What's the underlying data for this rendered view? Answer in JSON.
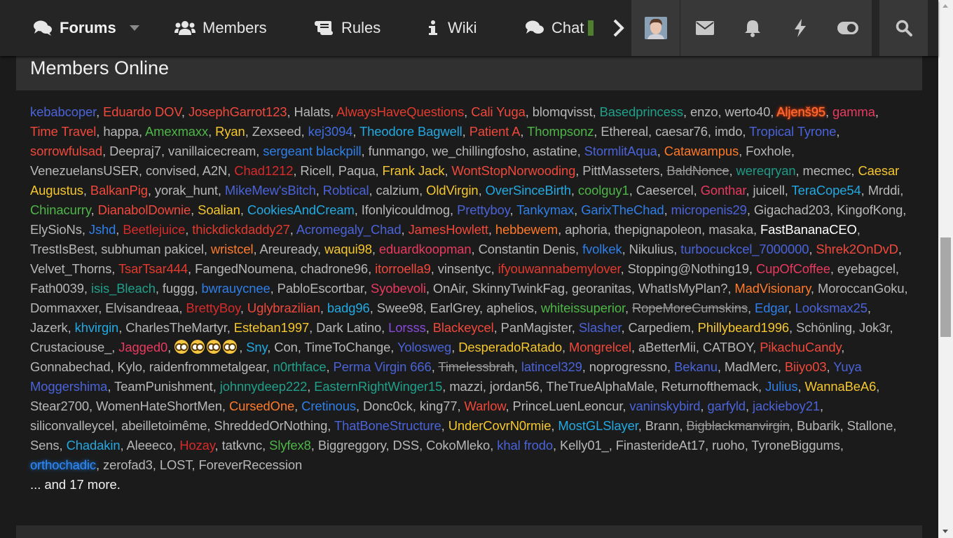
{
  "nav": {
    "forums": "Forums",
    "members": "Members",
    "rules": "Rules",
    "wiki": "Wiki",
    "chat": "Chat"
  },
  "icons": {
    "forums": "comments-icon",
    "members": "users-icon",
    "rules": "scroll-icon",
    "wiki": "info-icon",
    "chat": "chat-icon",
    "envelope": "envelope-icon",
    "bell": "bell-icon",
    "bolt": "bolt-icon",
    "toggle": "toggle-icon",
    "search": "search-icon"
  },
  "panel": {
    "title": "Members Online",
    "more_text": "... and 17 more."
  },
  "members": [
    {
      "name": "kebabcoper",
      "color": "#4a63d8"
    },
    {
      "name": "Eduardo DOV",
      "color": "#f0483b"
    },
    {
      "name": "JosephGarrot123",
      "color": "#f0483b"
    },
    {
      "name": "Halats",
      "color": ""
    },
    {
      "name": "AlwaysHaveQuestions",
      "color": "#e33a2e"
    },
    {
      "name": "Cali Yuga",
      "color": "#f0483b"
    },
    {
      "name": "blomqvisst",
      "color": ""
    },
    {
      "name": "Basedprincess",
      "color": "#20a08a"
    },
    {
      "name": "enzo",
      "color": ""
    },
    {
      "name": "werto40",
      "color": ""
    },
    {
      "name": "Aljenš95",
      "color": "",
      "style": "glow"
    },
    {
      "name": "gamma",
      "color": "#e83a5f"
    },
    {
      "name": "Time Travel",
      "color": "#f0483b"
    },
    {
      "name": "happa",
      "color": ""
    },
    {
      "name": "Amexmaxx",
      "color": "#4eb648"
    },
    {
      "name": "Ryan",
      "color": "#f5c62e"
    },
    {
      "name": "Zexseed",
      "color": ""
    },
    {
      "name": "kej3094",
      "color": "#3f6ddf"
    },
    {
      "name": "Theodore Bagwell",
      "color": "#23a9e1"
    },
    {
      "name": "Patient A",
      "color": "#f0483b"
    },
    {
      "name": "Thompsonz",
      "color": "#4eb648"
    },
    {
      "name": "Ethereal",
      "color": ""
    },
    {
      "name": "caesar76",
      "color": ""
    },
    {
      "name": "imdo",
      "color": ""
    },
    {
      "name": "Tropical Tyrone",
      "color": "#4a63d8"
    },
    {
      "name": "sorrowfulsad",
      "color": "#f0483b"
    },
    {
      "name": "Deepraj7",
      "color": ""
    },
    {
      "name": "vanillaicecream",
      "color": ""
    },
    {
      "name": "sergeant blackpill",
      "color": "#2f7fe8"
    },
    {
      "name": "funmango",
      "color": ""
    },
    {
      "name": "we_chillingfosho",
      "color": ""
    },
    {
      "name": "astatine",
      "color": ""
    },
    {
      "name": "StormlitAqua",
      "color": "#4a63d8"
    },
    {
      "name": "Catawampus",
      "color": "#ff7a2a"
    },
    {
      "name": "Foxhole",
      "color": ""
    },
    {
      "name": "VenezuelansUSER",
      "color": ""
    },
    {
      "name": "convised",
      "color": ""
    },
    {
      "name": "A2N",
      "color": ""
    },
    {
      "name": "Chad1212",
      "color": "#d62b2b"
    },
    {
      "name": "Ricell",
      "color": ""
    },
    {
      "name": "Paqua",
      "color": ""
    },
    {
      "name": "Frank Jack",
      "color": "#f5c62e"
    },
    {
      "name": "WontStopNorwooding",
      "color": "#f0483b"
    },
    {
      "name": "PittMasseters",
      "color": ""
    },
    {
      "name": "BaldNonce",
      "color": "",
      "style": "strike"
    },
    {
      "name": "wereqryan",
      "color": "#1f9a86"
    },
    {
      "name": "mecmec",
      "color": ""
    },
    {
      "name": "Caesar Augustus",
      "color": "#f5c62e"
    },
    {
      "name": "BalkanPig",
      "color": "#f0483b"
    },
    {
      "name": "yorak_hunt",
      "color": ""
    },
    {
      "name": "MikeMew'sBitch",
      "color": "#4a63d8"
    },
    {
      "name": "Robtical",
      "color": "#4a63d8"
    },
    {
      "name": "calzium",
      "color": ""
    },
    {
      "name": "OldVirgin",
      "color": "#f5c62e"
    },
    {
      "name": "OverSinceBirth",
      "color": "#23a9e1"
    },
    {
      "name": "coolguy1",
      "color": "#4eb648"
    },
    {
      "name": "Caesercel",
      "color": ""
    },
    {
      "name": "Gonthar",
      "color": "#e83a5f"
    },
    {
      "name": "juicell",
      "color": ""
    },
    {
      "name": "TeraCope54",
      "color": "#23a9e1"
    },
    {
      "name": "Mrddi",
      "color": ""
    },
    {
      "name": "Chinacurry",
      "color": "#4eb648"
    },
    {
      "name": "DianabolDownie",
      "color": "#f0483b"
    },
    {
      "name": "Soalian",
      "color": "#f5c62e"
    },
    {
      "name": "CookiesAndCream",
      "color": "#23a9e1"
    },
    {
      "name": "Ifonlyicouldmog",
      "color": ""
    },
    {
      "name": "Prettyboy",
      "color": "#4a63d8"
    },
    {
      "name": "Tankymax",
      "color": "#2f7fe8"
    },
    {
      "name": "GarixTheChad",
      "color": "#2f7fe8"
    },
    {
      "name": "micropenis29",
      "color": "#4a63d8"
    },
    {
      "name": "Gigachad203",
      "color": ""
    },
    {
      "name": "KingofKong",
      "color": ""
    },
    {
      "name": "ElySioNs",
      "color": ""
    },
    {
      "name": "Jshd",
      "color": "#2f7fe8"
    },
    {
      "name": "Beetlejuice",
      "color": "#d62b2b"
    },
    {
      "name": "thickdickdaddy27",
      "color": "#e33a2e"
    },
    {
      "name": "Acromegaly_Chad",
      "color": "#4a63d8"
    },
    {
      "name": "JamesHowlett",
      "color": "#f0483b"
    },
    {
      "name": "hebbewem",
      "color": "#ff7a2a"
    },
    {
      "name": "aphoria",
      "color": ""
    },
    {
      "name": "thepignapoleon",
      "color": ""
    },
    {
      "name": "masaka",
      "color": ""
    },
    {
      "name": "FastBananaCEO",
      "color": "",
      "style": "white"
    },
    {
      "name": "TrestIsBest",
      "color": ""
    },
    {
      "name": "subhuman pakicel",
      "color": ""
    },
    {
      "name": "wristcel",
      "color": "#ff7a2a"
    },
    {
      "name": "Areuready",
      "color": ""
    },
    {
      "name": "waqui98",
      "color": "#f5c62e"
    },
    {
      "name": "eduardkoopman",
      "color": "#e83a5f"
    },
    {
      "name": "Constantin Denis",
      "color": ""
    },
    {
      "name": "fvolkek",
      "color": "#2f7fe8"
    },
    {
      "name": "Nikulius",
      "color": ""
    },
    {
      "name": "turbocuckcel_7000000",
      "color": "#4a63d8"
    },
    {
      "name": "Shrek2OnDvD",
      "color": "#f0483b"
    },
    {
      "name": "Velvet_Thorns",
      "color": ""
    },
    {
      "name": "TsarTsar444",
      "color": "#e33a2e"
    },
    {
      "name": "FangedNoumena",
      "color": ""
    },
    {
      "name": "chadrone96",
      "color": ""
    },
    {
      "name": "itorroella9",
      "color": "#f0483b"
    },
    {
      "name": "vinsentyc",
      "color": ""
    },
    {
      "name": "ifyouwannabemylover",
      "color": "#e33a2e"
    },
    {
      "name": "Stopping@Nothing19",
      "color": ""
    },
    {
      "name": "CupOfCoffee",
      "color": "#e83a5f"
    },
    {
      "name": "eyebagcel",
      "color": ""
    },
    {
      "name": "Fath0039",
      "color": ""
    },
    {
      "name": "isis_Bleach",
      "color": "#20a08a"
    },
    {
      "name": "fuggg",
      "color": ""
    },
    {
      "name": "bwrauycnee",
      "color": "#2f7fe8"
    },
    {
      "name": "PabloEscortbar",
      "color": ""
    },
    {
      "name": "Syobevoli",
      "color": "#e83a5f"
    },
    {
      "name": "OnAir",
      "color": ""
    },
    {
      "name": "SkinnyTwinkFag",
      "color": ""
    },
    {
      "name": "georanitas",
      "color": ""
    },
    {
      "name": "WhatIsMyPlan?",
      "color": ""
    },
    {
      "name": "MadVisionary",
      "color": "#ff7a2a"
    },
    {
      "name": "MoroccanGoku",
      "color": ""
    },
    {
      "name": "Dommaxxer",
      "color": ""
    },
    {
      "name": "Elvisandreaa",
      "color": ""
    },
    {
      "name": "BrettyBoy",
      "color": "#d62b2b"
    },
    {
      "name": "Uglybrazilian",
      "color": "#f0483b"
    },
    {
      "name": "badg96",
      "color": "#23a9e1"
    },
    {
      "name": "Swee98",
      "color": ""
    },
    {
      "name": "EarlGrey",
      "color": ""
    },
    {
      "name": "aphelios",
      "color": ""
    },
    {
      "name": "whiteissuperior",
      "color": "#4eb648"
    },
    {
      "name": "RopeMoreCumskins",
      "color": "",
      "style": "strike"
    },
    {
      "name": "Edgar",
      "color": "#2f7fe8"
    },
    {
      "name": "Looksmax25",
      "color": "#4a63d8"
    },
    {
      "name": "Jazerk",
      "color": ""
    },
    {
      "name": "khvirgin",
      "color": "#23a9e1"
    },
    {
      "name": "CharlesTheMartyr",
      "color": ""
    },
    {
      "name": "Esteban1997",
      "color": "#f5c62e"
    },
    {
      "name": "Dark Latino",
      "color": ""
    },
    {
      "name": "Lorsss",
      "color": "#8a4ad8"
    },
    {
      "name": "Blackeycel",
      "color": "#f0483b"
    },
    {
      "name": "PanMagister",
      "color": ""
    },
    {
      "name": "Slasher",
      "color": "#4a63d8"
    },
    {
      "name": "Carpediem",
      "color": ""
    },
    {
      "name": "Phillybeard1996",
      "color": "#f5c62e"
    },
    {
      "name": "Schönling",
      "color": ""
    },
    {
      "name": "Jok3r",
      "color": ""
    },
    {
      "name": "Crustaciouse_",
      "color": ""
    },
    {
      "name": "Jagged0",
      "color": "#e83a5f"
    },
    {
      "name": "",
      "color": "",
      "style": "emoji"
    },
    {
      "name": "Sny",
      "color": "#23a9e1"
    },
    {
      "name": "Con",
      "color": ""
    },
    {
      "name": "TimeToChange",
      "color": ""
    },
    {
      "name": "Yolosweg",
      "color": "#4a63d8"
    },
    {
      "name": "DesperadoRatado",
      "color": "#f5c62e"
    },
    {
      "name": "Mongrelcel",
      "color": "#f0483b"
    },
    {
      "name": "aBetterMii",
      "color": ""
    },
    {
      "name": "CATBOY",
      "color": ""
    },
    {
      "name": "PikachuCandy",
      "color": "#f0483b"
    },
    {
      "name": "Gonnabechad",
      "color": ""
    },
    {
      "name": "Kylo",
      "color": ""
    },
    {
      "name": "raidenfrommetalgear",
      "color": ""
    },
    {
      "name": "n0rthface",
      "color": "#20a08a"
    },
    {
      "name": "Perma Virgin 666",
      "color": "#4a63d8"
    },
    {
      "name": "Timelessbrah",
      "color": "",
      "style": "strike"
    },
    {
      "name": "latincel329",
      "color": "#4a63d8"
    },
    {
      "name": "noprogressno",
      "color": ""
    },
    {
      "name": "Bekanu",
      "color": "#4a63d8"
    },
    {
      "name": "MadMerc",
      "color": ""
    },
    {
      "name": "Biiyo03",
      "color": "#f0483b"
    },
    {
      "name": "Yuya Moggershima",
      "color": "#4a63d8"
    },
    {
      "name": "TeamPunishment",
      "color": ""
    },
    {
      "name": "johnnydeep222",
      "color": "#20a08a"
    },
    {
      "name": "EasternRightWinger15",
      "color": "#20a08a"
    },
    {
      "name": "mazzi",
      "color": ""
    },
    {
      "name": "jordan56",
      "color": ""
    },
    {
      "name": "TheTrueAlphaMale",
      "color": ""
    },
    {
      "name": "Returnofthemack",
      "color": ""
    },
    {
      "name": "Julius",
      "color": "#2f7fe8"
    },
    {
      "name": "WannaBeA6",
      "color": "#f5c62e"
    },
    {
      "name": "Stear2700",
      "color": ""
    },
    {
      "name": "WomenHateShortMen",
      "color": ""
    },
    {
      "name": "CursedOne",
      "color": "#ff7a2a"
    },
    {
      "name": "Cretinous",
      "color": "#2f7fe8"
    },
    {
      "name": "Donc0ck",
      "color": ""
    },
    {
      "name": "king77",
      "color": ""
    },
    {
      "name": "Warlow",
      "color": "#f0483b"
    },
    {
      "name": "PrinceLuenLeoncur",
      "color": ""
    },
    {
      "name": "vaninskybird",
      "color": "#4a63d8"
    },
    {
      "name": "garfyld",
      "color": "#4a63d8"
    },
    {
      "name": "jackieboy21",
      "color": "#4a63d8"
    },
    {
      "name": "siliconvalleycel",
      "color": ""
    },
    {
      "name": "abeilletoimême",
      "color": ""
    },
    {
      "name": "ShreddedOrNothing",
      "color": ""
    },
    {
      "name": "ThatBoneStructure",
      "color": "#4a63d8"
    },
    {
      "name": "UnderCovrN0rmie",
      "color": "#f5c62e"
    },
    {
      "name": "MostGLSlayer",
      "color": "#23a9e1"
    },
    {
      "name": "Brann",
      "color": ""
    },
    {
      "name": "Bigblackmanvirgin",
      "color": "",
      "style": "strike"
    },
    {
      "name": "Bubarik",
      "color": ""
    },
    {
      "name": "Stallone",
      "color": ""
    },
    {
      "name": "Sens",
      "color": ""
    },
    {
      "name": "Chadakin",
      "color": "#23a9e1"
    },
    {
      "name": "Aleeeco",
      "color": ""
    },
    {
      "name": "Hozay",
      "color": "#d62b2b"
    },
    {
      "name": "tatkvnc",
      "color": ""
    },
    {
      "name": "Slyfex8",
      "color": "#4eb648"
    },
    {
      "name": "Biggreggory",
      "color": ""
    },
    {
      "name": "DSS",
      "color": ""
    },
    {
      "name": "CokoMleko",
      "color": ""
    },
    {
      "name": "khal frodo",
      "color": "#4a63d8"
    },
    {
      "name": "Kelly01_",
      "color": ""
    },
    {
      "name": "FinasterideAt17",
      "color": ""
    },
    {
      "name": "ruoho",
      "color": ""
    },
    {
      "name": "TyroneBiggums",
      "color": ""
    },
    {
      "name": "orthochadic",
      "color": "",
      "style": "glowblue"
    },
    {
      "name": "zerofad3",
      "color": ""
    },
    {
      "name": "LOST",
      "color": ""
    },
    {
      "name": "ForeverRecession",
      "color": ""
    }
  ]
}
